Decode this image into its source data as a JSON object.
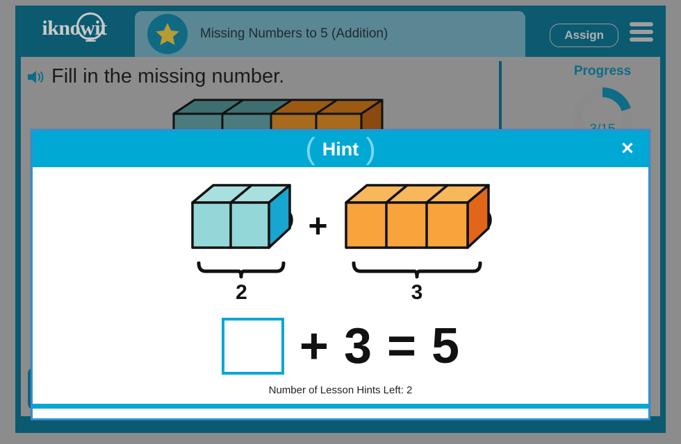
{
  "header": {
    "logo_text": "iknowit",
    "logo_icon": "lightbulb-icon",
    "star_icon": "star-icon",
    "lesson_title": "Missing Numbers to 5 (Addition)",
    "assign_label": "Assign",
    "menu_icon": "hamburger-menu-icon"
  },
  "content": {
    "speaker_icon": "speaker-icon",
    "prompt": "Fill in the missing number.",
    "progress": {
      "label": "Progress",
      "value_text": "3/15",
      "completed": 3,
      "total": 15,
      "arc_color": "#0d6c86",
      "track_color": "#8a8a8a"
    },
    "resize_icon": "resize-horizontal-icon"
  },
  "modal": {
    "title": "Hint",
    "close_icon": "close-icon",
    "left_paren": "(",
    "right_paren": ")",
    "blocks": [
      {
        "name": "teal-block",
        "count": 2,
        "label": "2",
        "face_color": "#94d7d8",
        "top_color": "#a8e0e0",
        "side_color": "#16a6d0"
      },
      {
        "name": "orange-block",
        "count": 3,
        "label": "3",
        "face_color": "#f8a33c",
        "top_color": "#f9b košil",
        "side_color": "#e2661a"
      }
    ],
    "operator": "+",
    "equation": {
      "answer_value": "",
      "answer_placeholder": "",
      "plus": "+",
      "addend": "3",
      "equals": "=",
      "sum": "5"
    },
    "footer": "Number of Lesson Hints Left: 2"
  },
  "colors": {
    "frame_teal": "#0b5a70",
    "canvas_gray": "#8c8c8c",
    "modal_cyan": "#00a8d4",
    "accent_blue": "#2f8fd6"
  }
}
